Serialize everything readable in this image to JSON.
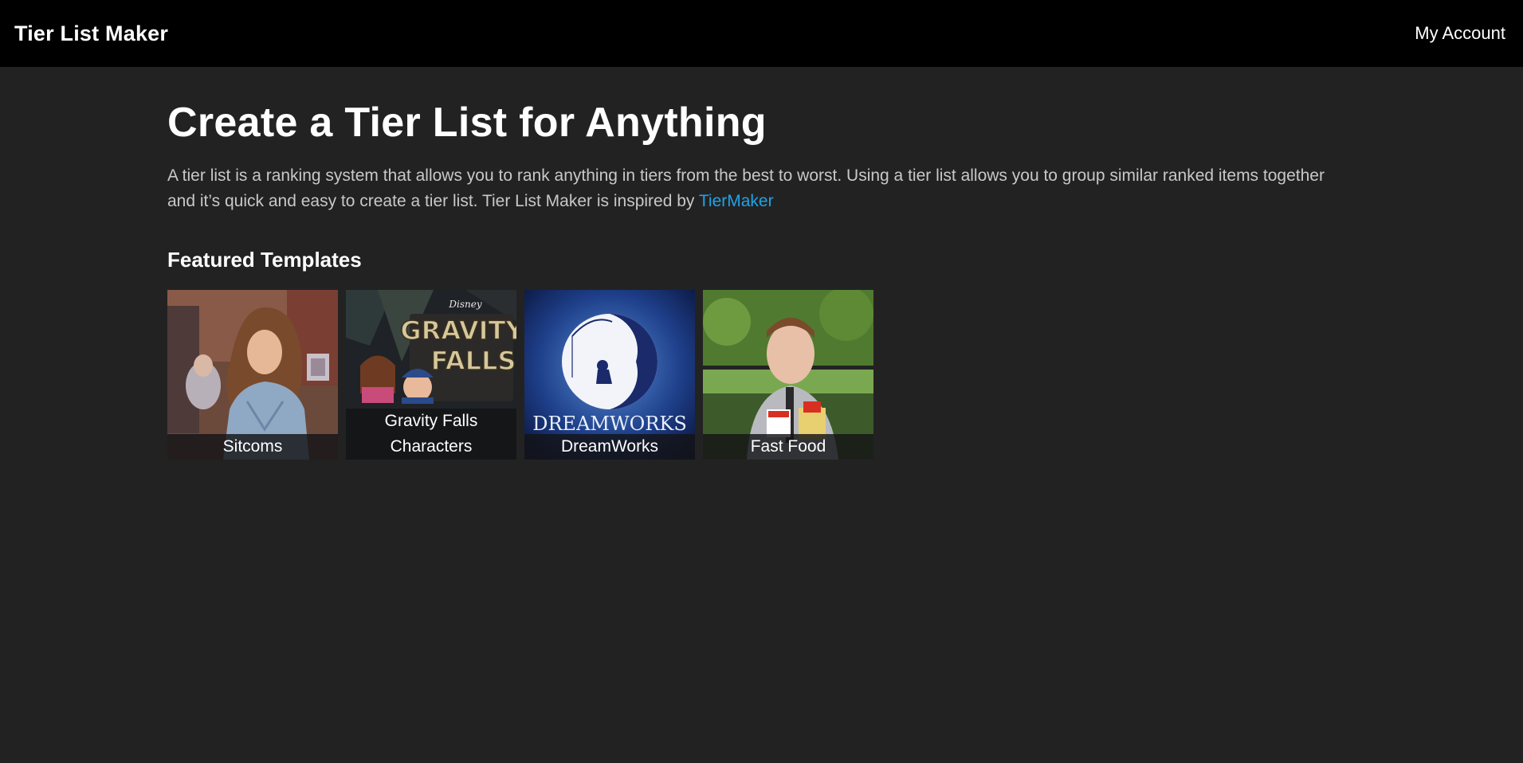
{
  "header": {
    "brand": "Tier List Maker",
    "account_label": "My Account"
  },
  "main": {
    "title": "Create a Tier List for Anything",
    "intro_text": "A tier list is a ranking system that allows you to rank anything in tiers from the best to worst. Using a tier list allows you to group similar ranked items together and it’s quick and easy to create a tier list. Tier List Maker is inspired by ",
    "intro_link": "TierMaker",
    "featured_heading": "Featured Templates",
    "templates": [
      {
        "label": "Sitcoms"
      },
      {
        "label": "Gravity Falls Characters",
        "art_text_top": "Disney",
        "art_text_1": "GRAVITY",
        "art_text_2": "FALLS"
      },
      {
        "label": "DreamWorks",
        "art_text": "DREAMWORKS"
      },
      {
        "label": "Fast Food"
      }
    ]
  },
  "colors": {
    "background": "#232223",
    "header": "#000000",
    "link": "#1ea4e6",
    "body_text": "#c8c8c8"
  }
}
